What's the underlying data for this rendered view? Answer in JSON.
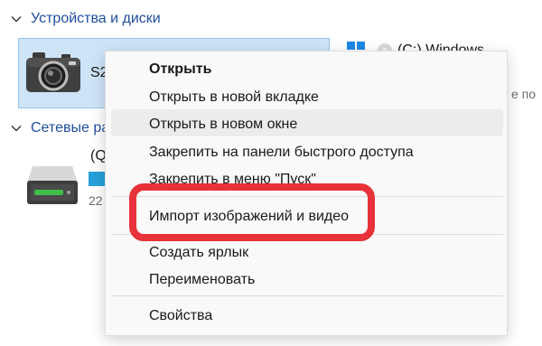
{
  "sections": {
    "devices_header": "Устройства и диски",
    "network_header": "Сетевые ра"
  },
  "devices": {
    "camera_name": "S2",
    "disk_label": "(C:) Windows",
    "free_space_text": "е по"
  },
  "network": {
    "drive_name": "(Q",
    "drive_size": "22"
  },
  "context_menu": {
    "items": [
      {
        "label": "Открыть"
      },
      {
        "label": "Открыть в новой вкладке"
      },
      {
        "label": "Открыть в новом окне"
      },
      {
        "label": "Закрепить на панели быстрого доступа"
      },
      {
        "label": "Закрепить в меню \"Пуск\""
      },
      {
        "label": "Импорт изображений и видео"
      },
      {
        "label": "Создать ярлык"
      },
      {
        "label": "Переименовать"
      },
      {
        "label": "Свойства"
      }
    ]
  },
  "colors": {
    "section_header": "#1f4e9c",
    "selection_fill": "#cde4f7",
    "highlight_annotation": "#e8323a",
    "drive_bar": "#26a0da"
  },
  "icons": [
    "chevron-down-icon",
    "camera-icon",
    "windows-logo-icon",
    "network-drive-icon"
  ]
}
